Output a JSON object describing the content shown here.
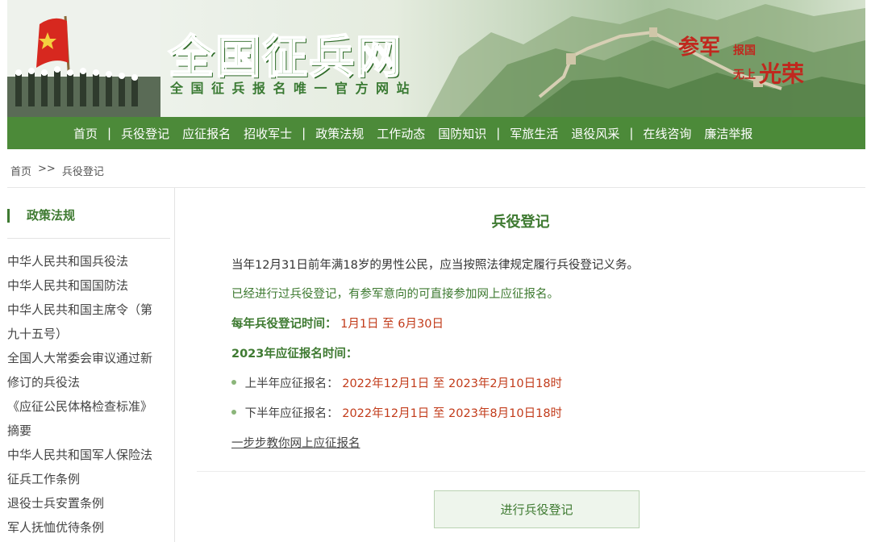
{
  "banner": {
    "logo_text": "全国征兵网",
    "tagline": "全国征兵报名唯一官方网站",
    "slogan": {
      "part1": "参军",
      "part2": "报国",
      "part3": "无上",
      "part4": "光荣"
    }
  },
  "nav": {
    "items": [
      "首页",
      "兵役登记",
      "应征报名",
      "招收军士",
      "政策法规",
      "工作动态",
      "国防知识",
      "军旅生活",
      "退役风采",
      "在线咨询",
      "廉洁举报"
    ],
    "separator": "|"
  },
  "breadcrumb": {
    "home": "首页",
    "sep": ">>",
    "current": "兵役登记"
  },
  "sidebar": {
    "title": "政策法规",
    "items": [
      "中华人民共和国兵役法",
      "中华人民共和国国防法",
      "中华人民共和国主席令（第",
      "九十五号）",
      "全国人大常委会审议通过新",
      "修订的兵役法",
      "《应征公民体格检查标准》",
      "摘要",
      "中华人民共和国军人保险法",
      "征兵工作条例",
      "退役士兵安置条例",
      "军人抚恤优待条例"
    ]
  },
  "main": {
    "title": "兵役登记",
    "line1": "当年12月31日前年满18岁的男性公民，应当按照法律规定履行兵役登记义务。",
    "line2": "已经进行过兵役登记，有参军意向的可直接参加网上应征报名。",
    "reg_time_label": "每年兵役登记时间：",
    "reg_time_value": "1月1日 至 6月30日",
    "apply_label": "2023年应征报名时间：",
    "first_half_label": "上半年应征报名：",
    "first_half_value": "2022年12月1日 至 2023年2月10日18时",
    "second_half_label": "下半年应征报名：",
    "second_half_value": "2022年12月1日 至 2023年8月10日18时",
    "guide_link": "一步步教你网上应征报名",
    "register_button": "进行兵役登记"
  },
  "colors": {
    "accent_green": "#4c8a39",
    "title_green": "#3e7a31",
    "highlight_red": "#c23b1a"
  }
}
